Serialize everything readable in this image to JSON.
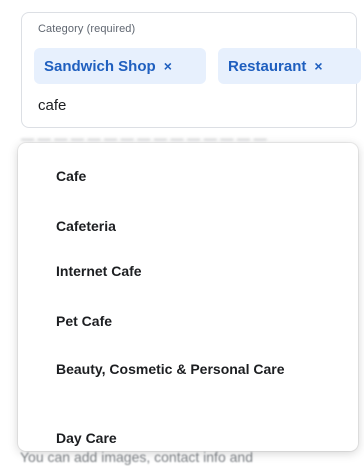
{
  "category_field": {
    "label": "Category (required)",
    "chips": [
      {
        "label": "Sandwich Shop",
        "remove_glyph": "×",
        "remove_icon": "close-icon"
      },
      {
        "label": "Restaurant",
        "remove_glyph": "×",
        "remove_icon": "close-icon"
      }
    ],
    "input_value": "cafe"
  },
  "dropdown": {
    "options": [
      {
        "label": "Cafe"
      },
      {
        "label": "Cafeteria"
      },
      {
        "label": "Internet Cafe"
      },
      {
        "label": "Pet Cafe"
      },
      {
        "label": "Beauty, Cosmetic & Personal Care"
      },
      {
        "label": "Day Care"
      }
    ]
  },
  "footer_hint": {
    "text": "You can add images, contact info and"
  },
  "colors": {
    "chip_background": "#e7f0fd",
    "chip_text": "#1f5fbf"
  }
}
